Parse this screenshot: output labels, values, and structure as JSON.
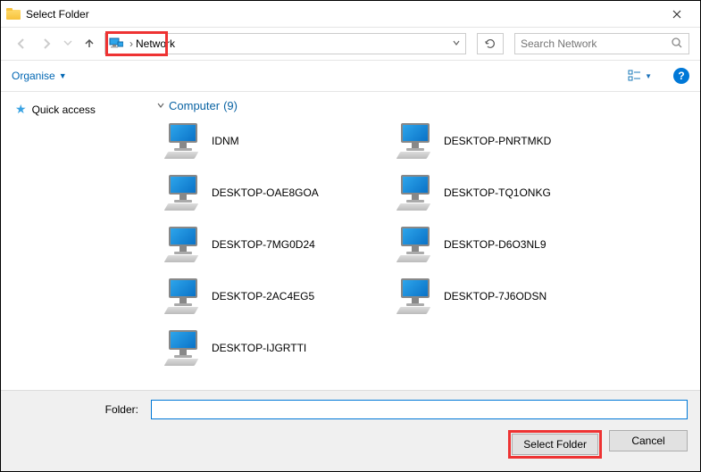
{
  "titlebar": {
    "title": "Select Folder"
  },
  "nav": {
    "location": "Network",
    "search_placeholder": "Search Network"
  },
  "toolbar": {
    "organise_label": "Organise"
  },
  "sidebar": {
    "quick_access": "Quick access"
  },
  "content": {
    "group_title": "Computer",
    "group_count": "(9)",
    "items": [
      {
        "label": "IDNM"
      },
      {
        "label": "DESKTOP-PNRTMKD"
      },
      {
        "label": "DESKTOP-OAE8GOA"
      },
      {
        "label": "DESKTOP-TQ1ONKG"
      },
      {
        "label": "DESKTOP-7MG0D24"
      },
      {
        "label": "DESKTOP-D6O3NL9"
      },
      {
        "label": "DESKTOP-2AC4EG5"
      },
      {
        "label": "DESKTOP-7J6ODSN"
      },
      {
        "label": "DESKTOP-IJGRTTI"
      }
    ]
  },
  "bottom": {
    "folder_label": "Folder:",
    "folder_value": "",
    "select_label": "Select Folder",
    "cancel_label": "Cancel"
  }
}
